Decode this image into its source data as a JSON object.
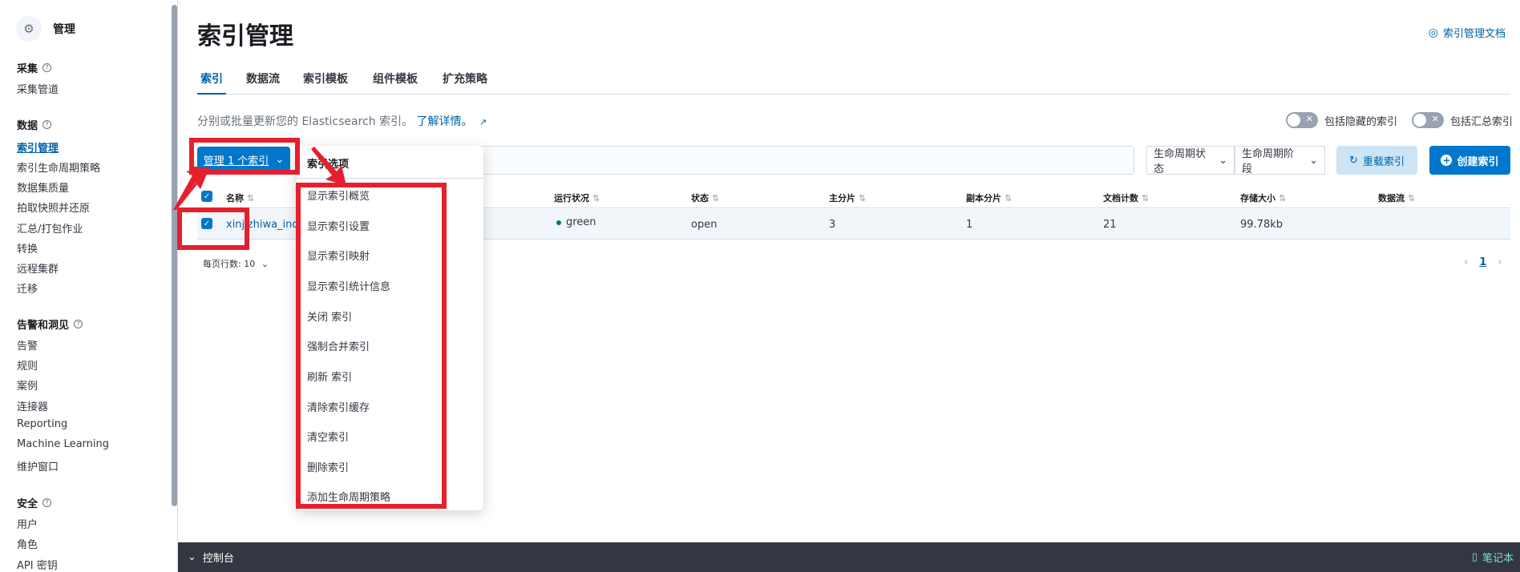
{
  "sidebar": {
    "header_title": "管理",
    "groups": {
      "ingest": "采集",
      "data": "数据",
      "alerts": "告警和洞见",
      "security": "安全"
    },
    "items": {
      "ingest_pipelines": "采集管道",
      "index_management": "索引管理",
      "ilm": "索引生命周期策略",
      "data_quality": "数据集质量",
      "snapshot": "拍取快照并还原",
      "rollup": "汇总/打包作业",
      "transforms": "转换",
      "remote_clusters": "远程集群",
      "migrate": "迁移",
      "alerts": "告警",
      "rules": "规则",
      "cases": "案例",
      "connectors": "连接器",
      "reporting": "Reporting",
      "ml": "Machine Learning",
      "maintenance": "维护窗口",
      "users": "用户",
      "roles": "角色",
      "api_keys": "API 密钥"
    }
  },
  "header": {
    "title": "索引管理",
    "doc_link": "索引管理文档"
  },
  "tabs": [
    "索引",
    "数据流",
    "索引模板",
    "组件模板",
    "扩充策略"
  ],
  "description": {
    "text": "分别或批量更新您的 Elasticsearch 索引。",
    "link": "了解详情。"
  },
  "toggles": {
    "hidden": "包括隐藏的索引",
    "rollup": "包括汇总索引"
  },
  "toolbar": {
    "manage_label": "管理 1 个索引",
    "lifecycle_status": "生命周期状态",
    "lifecycle_phase": "生命周期阶段",
    "reload": "重载索引",
    "create": "创建索引"
  },
  "table": {
    "columns": [
      "名称",
      "运行状况",
      "状态",
      "主分片",
      "副本分片",
      "文档计数",
      "存储大小",
      "数据流"
    ],
    "rows": [
      {
        "name": "xinjizhiwa_index",
        "health": "green",
        "status": "open",
        "primary": "3",
        "replica": "1",
        "docs": "21",
        "size": "99.78kb",
        "stream": ""
      }
    ],
    "rows_per_page": "每页行数: 10",
    "page": "1"
  },
  "popover": {
    "title": "索引选项",
    "items": [
      "显示索引概览",
      "显示索引设置",
      "显示索引映射",
      "显示索引统计信息",
      "关闭 索引",
      "强制合并索引",
      "刷新 索引",
      "清除索引缓存",
      "清空索引",
      "删除索引",
      "添加生命周期策略"
    ]
  },
  "console": {
    "label": "控制台",
    "notebook": "笔记本"
  },
  "colors": {
    "primary": "#0077cc",
    "highlight": "#e5202e"
  }
}
